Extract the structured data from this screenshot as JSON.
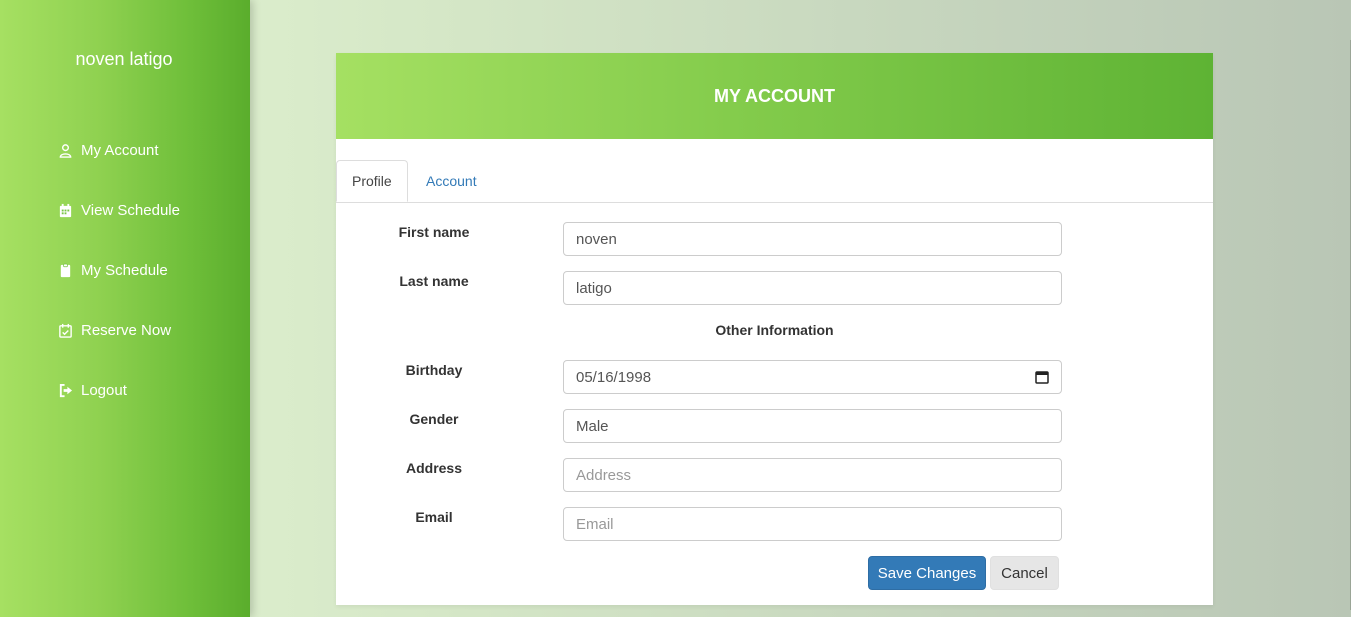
{
  "sidebar": {
    "user_name": "noven latigo",
    "items": [
      {
        "label": "My Account",
        "icon": "user-icon"
      },
      {
        "label": "View Schedule",
        "icon": "calendar-icon"
      },
      {
        "label": "My Schedule",
        "icon": "clipboard-icon"
      },
      {
        "label": "Reserve Now",
        "icon": "calendar-check-icon"
      },
      {
        "label": "Logout",
        "icon": "logout-icon"
      }
    ]
  },
  "card": {
    "title": "MY ACCOUNT",
    "tabs": [
      {
        "label": "Profile",
        "active": true
      },
      {
        "label": "Account",
        "active": false
      }
    ]
  },
  "form": {
    "first_name": {
      "label": "First name",
      "value": "noven"
    },
    "last_name": {
      "label": "Last name",
      "value": "latigo"
    },
    "section_title": "Other Information",
    "birthday": {
      "label": "Birthday",
      "value": "05/16/1998"
    },
    "gender": {
      "label": "Gender",
      "value": "Male"
    },
    "address": {
      "label": "Address",
      "value": "",
      "placeholder": "Address"
    },
    "email": {
      "label": "Email",
      "value": "",
      "placeholder": "Email"
    },
    "save_label": "Save Changes",
    "cancel_label": "Cancel"
  },
  "colors": {
    "accent": "#5eb334",
    "primary_button": "#337ab7",
    "link": "#337ab7"
  }
}
